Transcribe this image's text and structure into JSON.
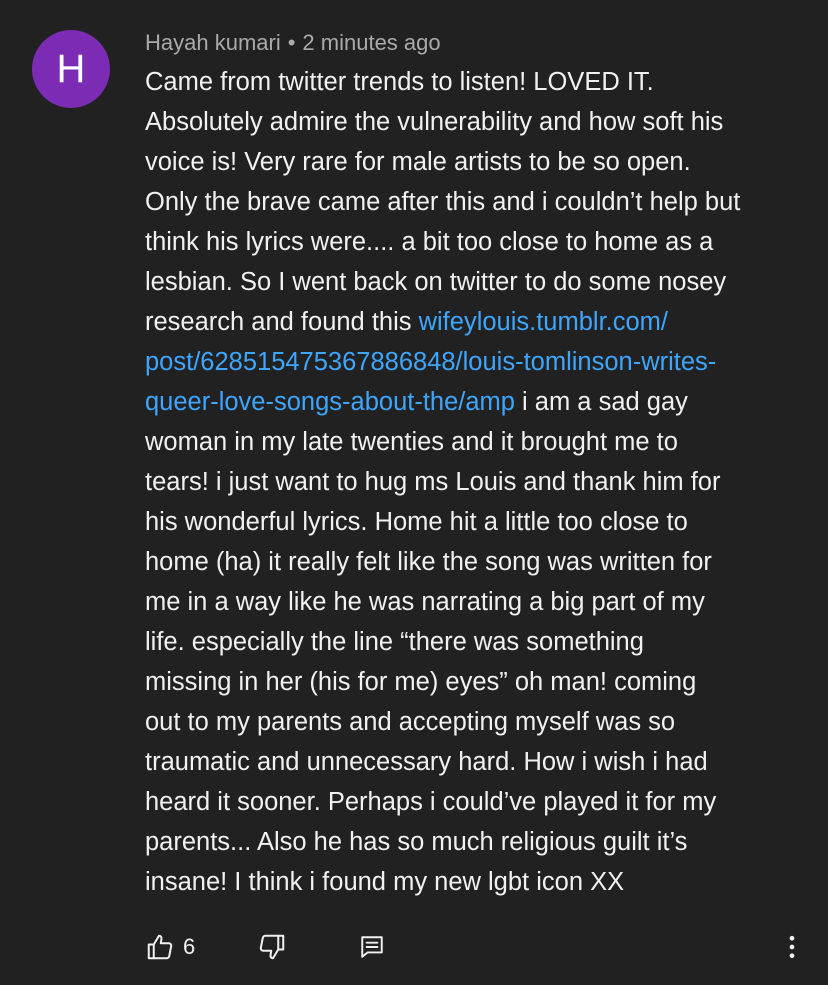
{
  "author": {
    "initial": "H",
    "name": "Hayah kumari",
    "separator": "•",
    "time": "2 minutes ago",
    "avatar_color": "#7b2bb4"
  },
  "comment": {
    "line_01": "Came from twitter trends to listen! LOVED IT.",
    "line_02": "Absolutely admire the vulnerability and how soft his",
    "line_03": "voice is! Very rare for male artists to be so open.",
    "line_04": "Only the brave came after this and i couldn’t help but",
    "line_05": "think his lyrics were.... a bit too close to home as a",
    "line_06": "lesbian. So I went back on twitter to do some nosey",
    "line_07_text": "research and found this ",
    "link_part_1": "wifeylouis.tumblr.com/",
    "link_part_2": "post/628515475367886848/louis-tomlinson-writes-",
    "link_part_3": "queer-love-songs-about-the/amp",
    "line_09_text": " i am a sad gay",
    "line_10": "woman in my late twenties and it brought me to",
    "line_11": "tears! i just want to hug ms Louis and thank him for",
    "line_12": "his wonderful lyrics. Home hit a little too close to",
    "line_13": "home (ha) it really felt like the song was written for",
    "line_14": "me in a way like he was narrating a big part of my",
    "line_15": "life. especially the line “there was something",
    "line_16": "missing in her (his for me) eyes” oh man! coming",
    "line_17": "out to my parents and accepting myself was so",
    "line_18": "traumatic and unnecessary hard. How i wish i had",
    "line_19": "heard it sooner. Perhaps i could’ve played it for my",
    "line_20": "parents... Also he has so much religious guilt it’s",
    "line_21": "insane! I think i found my new lgbt icon XX"
  },
  "actions": {
    "like_icon": "thumbs-up-icon",
    "like_count": "6",
    "dislike_icon": "thumbs-down-icon",
    "reply_icon": "reply-comment-icon",
    "more_icon": "more-vertical-icon"
  },
  "colors": {
    "background": "#212121",
    "text": "#f1f1f1",
    "meta": "#aaaaaa",
    "link": "#3ea6ff"
  }
}
